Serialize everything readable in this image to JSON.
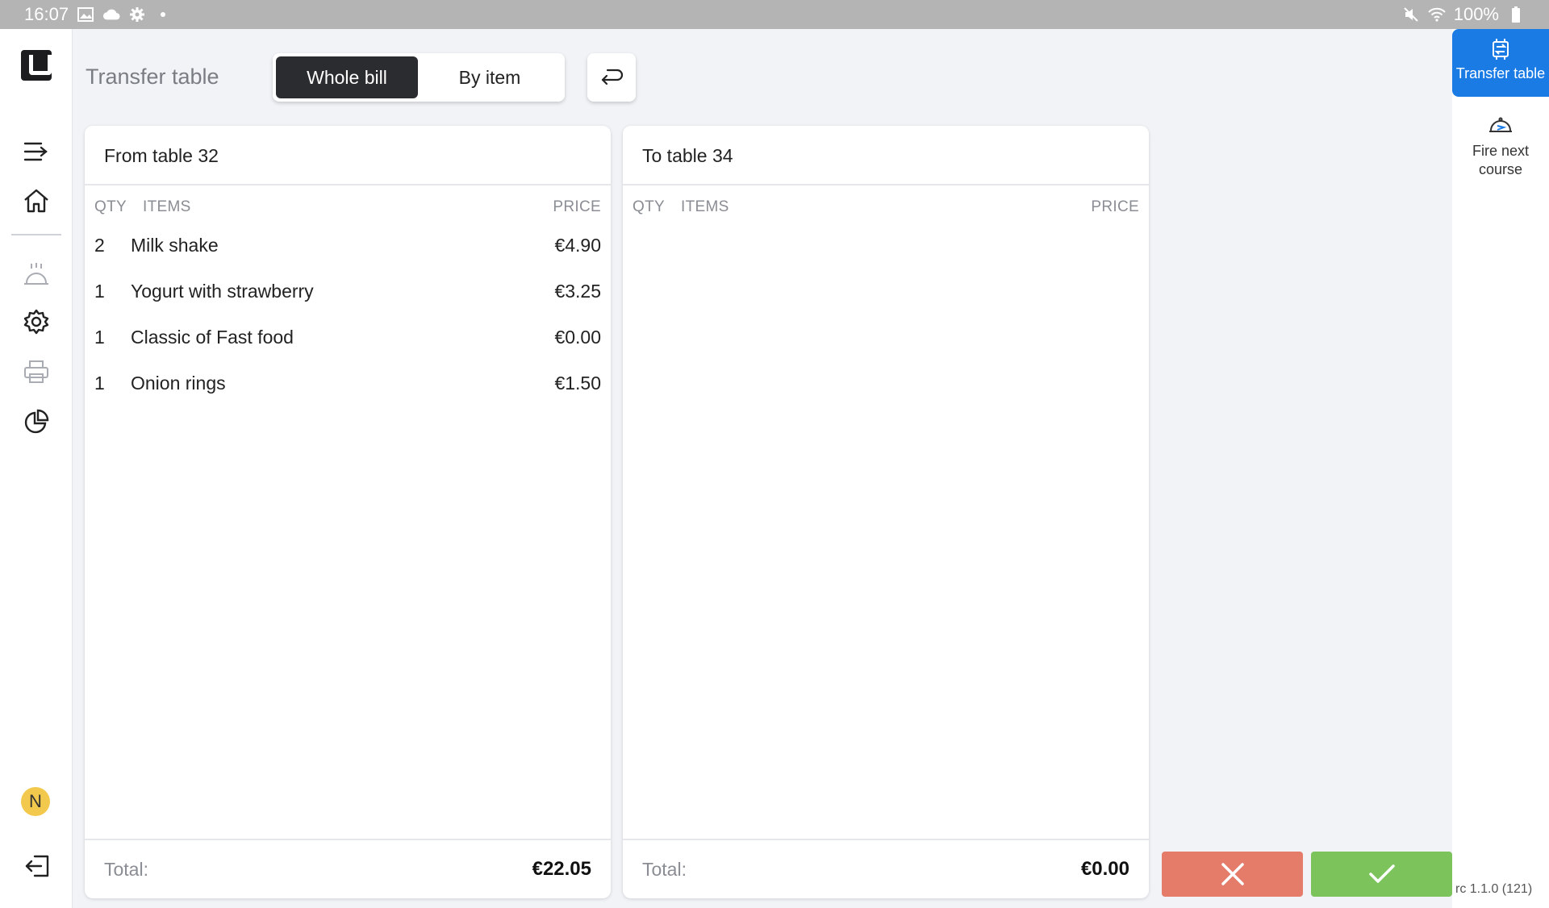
{
  "status_bar": {
    "time": "16:07",
    "battery": "100%"
  },
  "header": {
    "title": "Transfer table",
    "mode_whole_bill": "Whole bill",
    "mode_by_item": "By item"
  },
  "from_panel": {
    "title": "From table 32",
    "col_qty": "QTY",
    "col_items": "ITEMS",
    "col_price": "PRICE",
    "items": [
      {
        "qty": "2",
        "name": "Milk shake",
        "price": "€4.90"
      },
      {
        "qty": "1",
        "name": "Yogurt with strawberry",
        "price": "€3.25"
      },
      {
        "qty": "1",
        "name": "Classic of Fast food",
        "price": "€0.00"
      },
      {
        "qty": "1",
        "name": "Onion rings",
        "price": "€1.50"
      }
    ],
    "total_label": "Total:",
    "total": "€22.05"
  },
  "to_panel": {
    "title": "To table 34",
    "col_qty": "QTY",
    "col_items": "ITEMS",
    "col_price": "PRICE",
    "total_label": "Total:",
    "total": "€0.00"
  },
  "user": {
    "initial": "N"
  },
  "right_bar": {
    "transfer_label": "Transfer table",
    "fire_label": "Fire next course",
    "version": "rc 1.1.0 (121)"
  },
  "colors": {
    "accent": "#1a7be5",
    "confirm": "#7cc35c",
    "cancel": "#e57c6a",
    "segment_active": "#2b2c2f"
  }
}
